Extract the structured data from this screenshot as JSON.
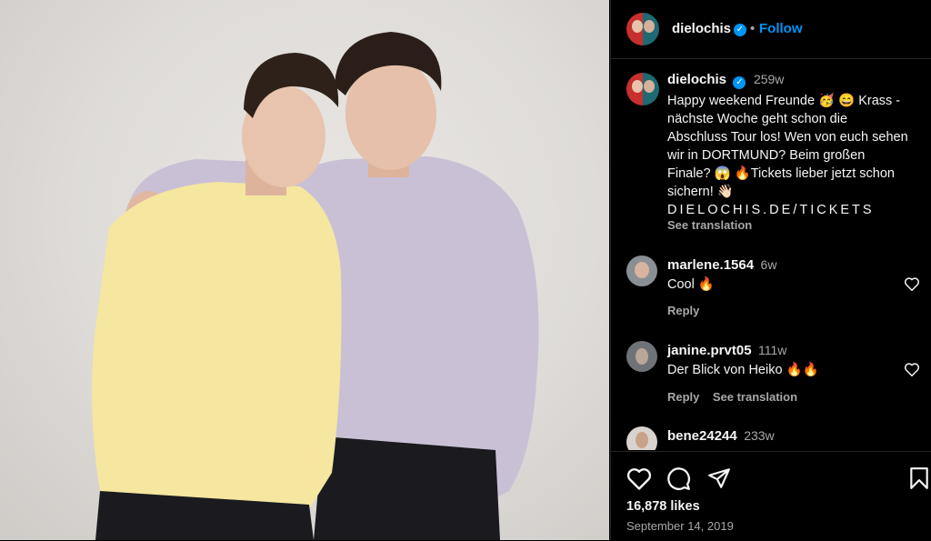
{
  "post": {
    "author": "dielochis",
    "follow_label": "Follow",
    "separator": "•",
    "verified_mark": "✓",
    "likes": "16,878 likes",
    "date": "September 14, 2019",
    "icons": [
      "heart-icon",
      "comment-icon",
      "share-icon",
      "bookmark-icon"
    ]
  },
  "caption": {
    "author": "dielochis",
    "time": "259w",
    "lines": [
      "Happy weekend Freunde 🥳 😄  Krass -",
      "nächste Woche geht schon die",
      "Abschluss Tour los! Wen von euch sehen",
      "wir in DORTMUND? Beim großen",
      "Finale? 😱 🔥Tickets lieber jetzt schon",
      "sichern! 👋🏻"
    ],
    "link": "DIELOCHIS.DE/TICKETS",
    "see_translation": "See translation"
  },
  "comments": [
    {
      "user": "marlene.1564",
      "time": "6w",
      "text": "Cool 🔥",
      "reply": "Reply"
    },
    {
      "user": "janine.prvt05",
      "time": "111w",
      "text": "Der Blick von Heiko 🔥🔥",
      "reply": "Reply",
      "see_translation": "See translation"
    },
    {
      "user": "bene24244",
      "time": "233w"
    }
  ],
  "colors": {
    "accent": "#0095f6",
    "background": "#000000",
    "muted": "#a8a8a8",
    "yellow_sweater": "#f5e6a0",
    "lilac_sweater": "#c9c0d6"
  }
}
